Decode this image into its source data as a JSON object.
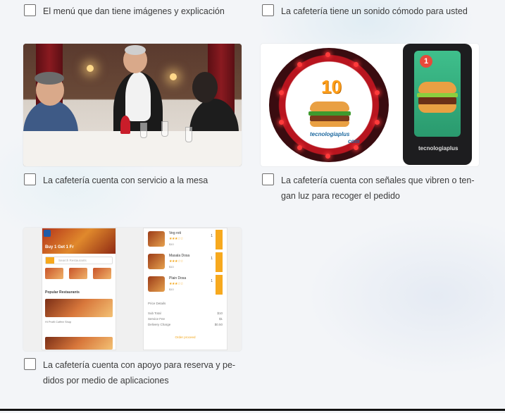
{
  "options": {
    "menu_images": "El menú que dan tiene imágenes y explicación",
    "sound": "La cafetería tiene un sonido cómodo para usted",
    "table_service": "La cafetería cuenta con servicio a la mesa",
    "pager_line1": "La cafetería cuenta con señales que vibren o ten-",
    "pager_line2": "gan luz para recoger el pedido",
    "app_line1": "La cafetería cuenta con apoyo para reserva y pe-",
    "app_line2": "didos por medio de aplicaciones"
  },
  "pager_image": {
    "number": "10",
    "brand": "tecnologiaplus",
    "brand_suffix": "com",
    "phone_badge": "1",
    "phone_label": "tecnologiaplus"
  },
  "app_image": {
    "promo": "Buy 1 Get 1 Fr",
    "search_placeholder": "Search Restaurants",
    "section": "Popular Restaurants",
    "restaurant": "Hi Profil Coffee Shop",
    "items": [
      {
        "name": "Veg roti",
        "stars": "★★★☆☆",
        "price": "$10",
        "qty": "1"
      },
      {
        "name": "Masala Dosa",
        "stars": "★★★☆☆",
        "price": "$10",
        "qty": "1"
      },
      {
        "name": "Plain Dosa",
        "stars": "★★★☆☆",
        "price": "$10",
        "qty": "1"
      }
    ],
    "price_details": "Price Details",
    "sub_total": "Sub Total",
    "sub_total_val": "$10",
    "service_fee": "Service Fee",
    "service_fee_val": "$1",
    "delivery": "Delivery Charge",
    "delivery_val": "$0.50",
    "cta": "Order proceed"
  },
  "colors": {
    "accent": "#f7a91e",
    "pager_red": "#b8151f"
  }
}
